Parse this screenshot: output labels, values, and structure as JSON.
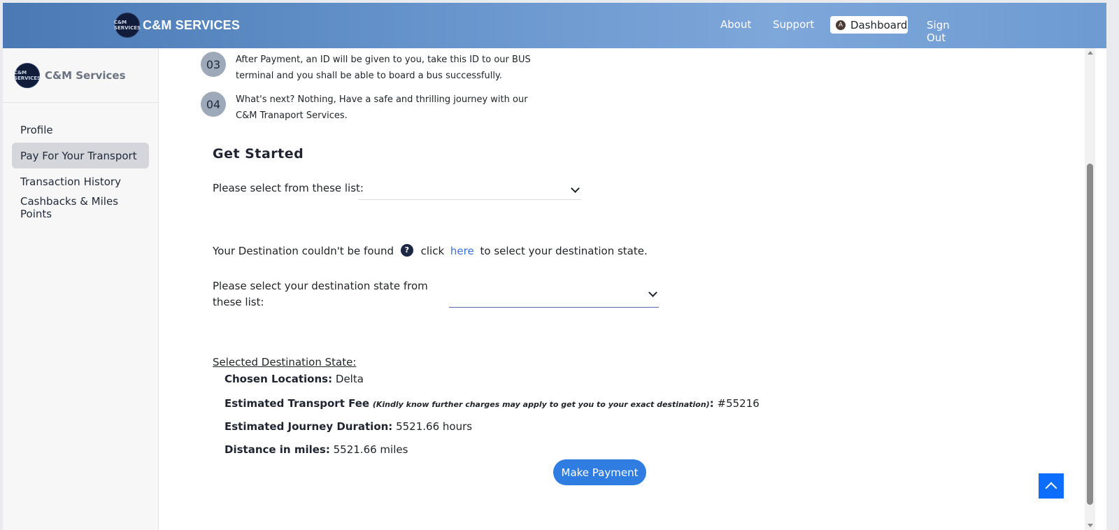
{
  "navbar": {
    "brand": "C&M SERVICES",
    "logo_text": "C&M SERVICES",
    "links": {
      "about": "About",
      "support": "Support",
      "dashboard": "Dashboard",
      "sign_out": "Sign Out"
    },
    "avatar_initial": "A"
  },
  "sidebar": {
    "brand": "C&M Services",
    "items": [
      {
        "label": "Profile",
        "active": false
      },
      {
        "label": "Pay For Your Transport",
        "active": true
      },
      {
        "label": "Transaction History",
        "active": false
      },
      {
        "label": "Cashbacks & Miles Points",
        "active": false
      }
    ]
  },
  "steps": [
    {
      "num": "03",
      "text": "After Payment, an ID will be given to you, take this ID to our BUS terminal and you shall be able to board a bus successfully."
    },
    {
      "num": "04",
      "text": "What's next? Nothing, Have a safe and thrilling journey with our C&M Tranaport Services."
    }
  ],
  "form": {
    "heading": "Get Started",
    "select1_label": "Please select from these list:",
    "select1_value": "",
    "not_found_pre": "Your Destination couldn't be found",
    "not_found_click": "click",
    "not_found_link": "here",
    "not_found_post": "to select your destination state.",
    "select2_label": "Please select your destination state from these list:",
    "select2_value": ""
  },
  "summary": {
    "title": "Selected Destination State:",
    "location_label": "Chosen Locations:",
    "location_value": "Delta",
    "fee_label": "Estimated Transport Fee",
    "fee_note": "(Kindly know further charges may apply to get you to your exact destination)",
    "fee_value": "#55216",
    "duration_label": "Estimated Journey Duration:",
    "duration_value": "5521.66 hours",
    "distance_label": "Distance in miles:",
    "distance_value": "5521.66 miles"
  },
  "buttons": {
    "make_payment": "Make Payment"
  },
  "icons": {
    "question": "?",
    "back_to_top": "chevron-up-icon"
  },
  "colors": {
    "primary": "#2f7de1",
    "link": "#3a6fd8",
    "active_item": "#d4d6db"
  }
}
